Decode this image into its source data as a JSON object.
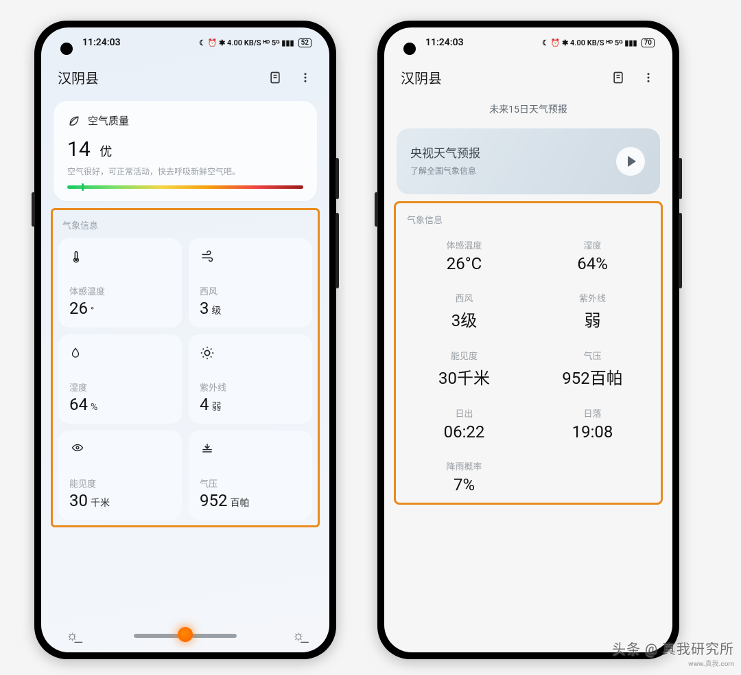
{
  "status": {
    "time": "11:24:03",
    "icons": "☾ ⏰ ✱ 4.00 KB/S ᴴᴰ 5ᴳ ▮▮▮",
    "batt_l": "52",
    "batt_r": "70"
  },
  "app": {
    "location": "汉阴县"
  },
  "aq": {
    "title": "空气质量",
    "value": "14",
    "grade": "优",
    "desc": "空气很好，可正常活动，快去呼吸新鲜空气吧。"
  },
  "meteo_title": "气象信息",
  "left_tiles": [
    {
      "icon": "thermo",
      "label": "体感温度",
      "value": "26",
      "unit": "°"
    },
    {
      "icon": "wind",
      "label": "西风",
      "value": "3",
      "unit": "级"
    },
    {
      "icon": "drop",
      "label": "湿度",
      "value": "64",
      "unit": "%"
    },
    {
      "icon": "sun",
      "label": "紫外线",
      "value": "4",
      "unit": "弱"
    },
    {
      "icon": "eye",
      "label": "能见度",
      "value": "30",
      "unit": "千米"
    },
    {
      "icon": "press",
      "label": "气压",
      "value": "952",
      "unit": "百帕"
    }
  ],
  "forecast_link": "未来15日天气预报",
  "cctv": {
    "title": "央视天气预报",
    "sub": "了解全国气象信息"
  },
  "right_cells": [
    {
      "label": "体感温度",
      "value": "26°C"
    },
    {
      "label": "湿度",
      "value": "64%"
    },
    {
      "label": "西风",
      "value": "3级"
    },
    {
      "label": "紫外线",
      "value": "弱"
    },
    {
      "label": "能见度",
      "value": "30千米"
    },
    {
      "label": "气压",
      "value": "952百帕"
    },
    {
      "label": "日出",
      "value": "06:22"
    },
    {
      "label": "日落",
      "value": "19:08"
    },
    {
      "label": "降雨概率",
      "value": "7%"
    }
  ],
  "watermark": {
    "main": "头条 @ 真我研究所",
    "sub": "www.真我.com"
  }
}
